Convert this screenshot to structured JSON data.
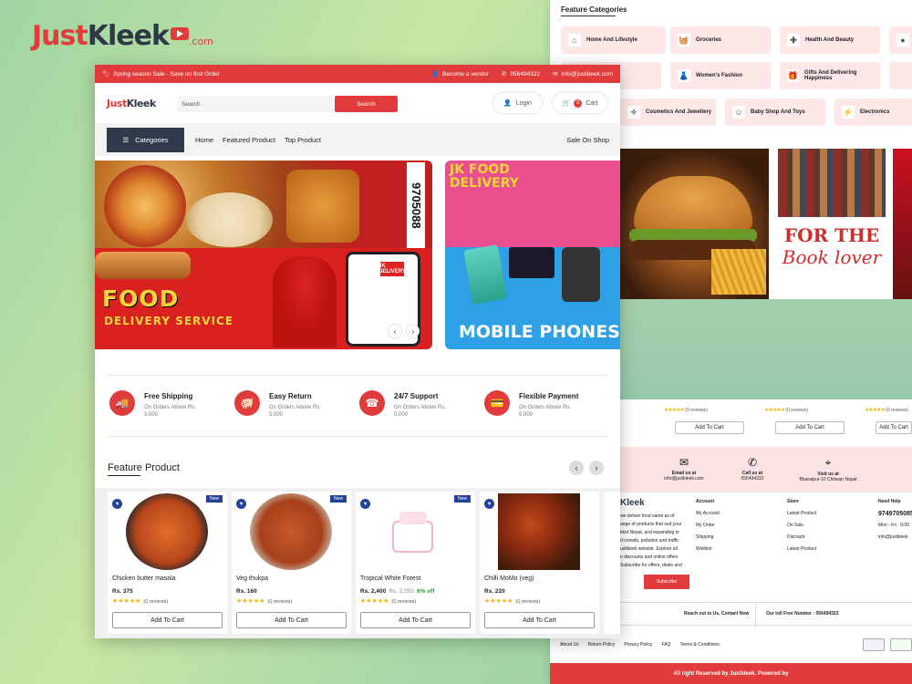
{
  "brand": {
    "name_part1": "Just",
    "name_part2": "Kleek",
    "domain": ".com"
  },
  "bg_page": {
    "feature_categories_title": "Feature Categories",
    "categories": [
      "Home And Lifestyle",
      "Groceries",
      "Health And Beauty",
      "Women's Fashion",
      "Gifts And Delivering Happiness",
      "Cosmetics And Jewellery",
      "Baby Shop And Toys",
      "Electronics"
    ],
    "banner_book_line1": "FOR THE",
    "banner_book_line2": "Book lover",
    "cart_label": "Add To Cart",
    "reviews": "(0 reviews)",
    "contact": [
      {
        "label": "Email us at",
        "value": "info@justkleek.com"
      },
      {
        "label": "Call us at",
        "value": "056494322"
      },
      {
        "label": "Visit us at",
        "value": "Bharatpur-10 Chitwan Nepal"
      }
    ],
    "about_lines": [
      "we deliver food same as of",
      "ange of products that suit your",
      "kkot Nepal, and expanding in",
      "d crowds, pollution and traffic",
      "ustkleek website. Explore all",
      "e discounts and online offers",
      "Subscribe for offers, deals and"
    ],
    "account": {
      "title": "Account",
      "items": [
        "My Account",
        "My Order",
        "Shipping",
        "Wishlist"
      ]
    },
    "store": {
      "title": "Store",
      "items": [
        "Latest Product",
        "On Sale",
        "Discount",
        "Latest Product"
      ]
    },
    "help": {
      "title": "Need Help",
      "phone": "9749705085",
      "hours": "Mon - Fri : 9:00",
      "email": "info@justkleek"
    },
    "subscribe": "Subscribe",
    "reach": "Reach out to Us, Contact Now",
    "toll": "Our toll Free Number : 056494322",
    "footer_links": [
      "About Us",
      "Return Policy",
      "Privacy Policy",
      "FAQ",
      "Terms & Conditions"
    ],
    "copyright": "All right Reserved by Justkleek. Powered by"
  },
  "topbar": {
    "promo": "Spring season Sale - Save on first Order",
    "vendor": "Become a vendor",
    "phone": "056494322",
    "email": "info@justkleek.com"
  },
  "header": {
    "search_placeholder": "Search",
    "search_button": "Search",
    "login": "Login",
    "cart_count": "0",
    "cart": "Cart"
  },
  "nav": {
    "categories": "Categories",
    "links": [
      "Home",
      "Featured Product",
      "Top Product"
    ],
    "sale": "Sale On Shop"
  },
  "banners": {
    "food_title": "FOOD",
    "food_sub": "DELIVERY SERVICE",
    "phone_number": "9705088",
    "jk_badge": "JK DELIVERY",
    "jk_food_line1": "JK FOOD",
    "jk_food_line2": "DELIVERY",
    "mobile": "MOBILE PHONES"
  },
  "features": [
    {
      "title": "Free Shipping",
      "sub": "On Orders Above Rs. 5,000"
    },
    {
      "title": "Easy Return",
      "sub": "On Orders Above Rs. 5,000"
    },
    {
      "title": "24/7 Support",
      "sub": "On Orders Above Rs. 5,000"
    },
    {
      "title": "Flexible Payment",
      "sub": "On Orders Above Rs. 5,000"
    }
  ],
  "feature_product": {
    "title": "Feature Product",
    "products": [
      {
        "name": "Chicken butter masala",
        "price": "Rs. 375",
        "old": "",
        "off": "",
        "reviews": "(0 reviews)",
        "badge": "New",
        "cart": "Add To Cart"
      },
      {
        "name": "Veg thukpa",
        "price": "Rs. 160",
        "old": "",
        "off": "",
        "reviews": "(0 reviews)",
        "badge": "New",
        "cart": "Add To Cart"
      },
      {
        "name": "Tropical White Forest",
        "price": "Rs. 2,400",
        "old": "Rs. 2,550",
        "off": "6% off",
        "reviews": "(0 reviews)",
        "badge": "New",
        "cart": "Add To Cart"
      },
      {
        "name": "Chilli MoMo (veg)",
        "price": "Rs. 220",
        "old": "",
        "off": "",
        "reviews": "(0 reviews)",
        "badge": "",
        "cart": "Add To Cart"
      }
    ]
  },
  "colors": {
    "accent": "#e23b3b",
    "dark": "#2f3a4b",
    "badge_blue": "#23419b",
    "star": "#f5b50a"
  }
}
